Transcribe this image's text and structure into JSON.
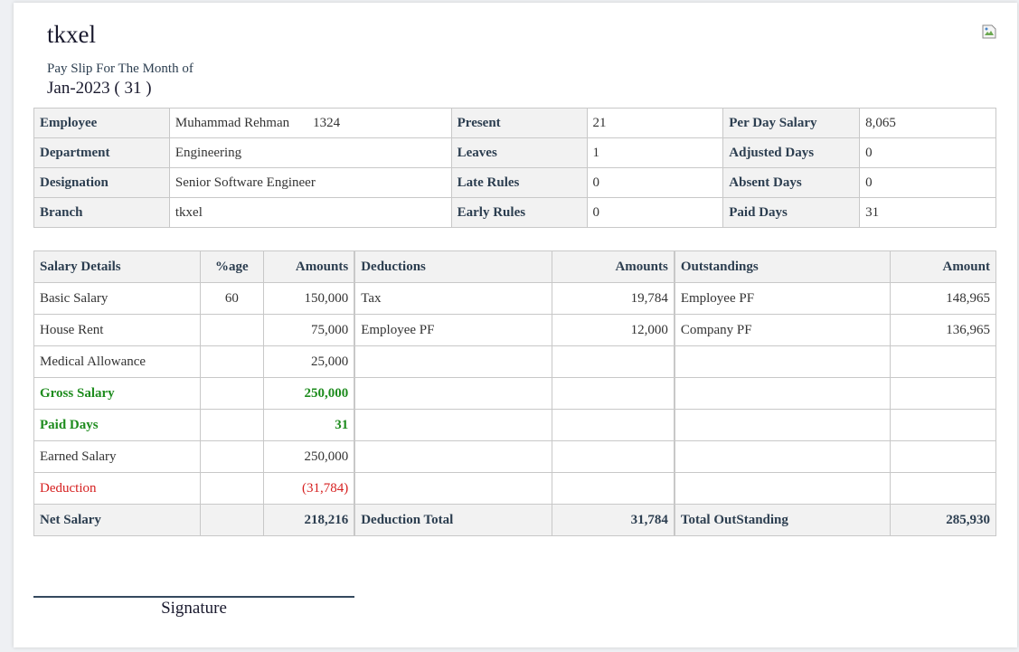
{
  "header": {
    "company": "tkxel",
    "subtitle": "Pay Slip For The Month of",
    "period": "Jan-2023 ( 31 )"
  },
  "info": {
    "employee_label": "Employee",
    "employee_name": "Muhammad Rehman",
    "employee_id": "1324",
    "department_label": "Department",
    "department": "Engineering",
    "designation_label": "Designation",
    "designation": "Senior Software Engineer",
    "branch_label": "Branch",
    "branch": "tkxel",
    "present_label": "Present",
    "present": "21",
    "leaves_label": "Leaves",
    "leaves": "1",
    "late_label": "Late Rules",
    "late": "0",
    "early_label": "Early Rules",
    "early": "0",
    "perday_label": "Per Day Salary",
    "perday": "8,065",
    "adjusted_label": "Adjusted Days",
    "adjusted": "0",
    "absent_label": "Absent Days",
    "absent": "0",
    "paid_label": "Paid Days",
    "paid": "31"
  },
  "salary": {
    "headers": {
      "details": "Salary Details",
      "pct": "%age",
      "amounts": "Amounts",
      "deductions": "Deductions",
      "ded_amounts": "Amounts",
      "outstandings": "Outstandings",
      "out_amount": "Amount"
    },
    "rows": [
      {
        "name": "Basic Salary",
        "pct": "60",
        "amount": "150,000",
        "ded": "Tax",
        "ded_amount": "19,784",
        "out": "Employee PF",
        "out_amount": "148,965"
      },
      {
        "name": "House Rent",
        "pct": "",
        "amount": "75,000",
        "ded": "Employee PF",
        "ded_amount": "12,000",
        "out": "Company PF",
        "out_amount": "136,965"
      },
      {
        "name": "Medical Allowance",
        "pct": "",
        "amount": "25,000",
        "ded": "",
        "ded_amount": "",
        "out": "",
        "out_amount": ""
      },
      {
        "name": "Gross Salary",
        "pct": "",
        "amount": "250,000",
        "ded": "",
        "ded_amount": "",
        "out": "",
        "out_amount": ""
      },
      {
        "name": "Paid Days",
        "pct": "",
        "amount": "31",
        "ded": "",
        "ded_amount": "",
        "out": "",
        "out_amount": ""
      },
      {
        "name": "Earned Salary",
        "pct": "",
        "amount": "250,000",
        "ded": "",
        "ded_amount": "",
        "out": "",
        "out_amount": ""
      },
      {
        "name": "Deduction",
        "pct": "",
        "amount": "(31,784)",
        "ded": "",
        "ded_amount": "",
        "out": "",
        "out_amount": ""
      }
    ],
    "totals": {
      "net_label": "Net Salary",
      "net": "218,216",
      "ded_label": "Deduction Total",
      "ded_total": "31,784",
      "out_label": "Total OutStanding",
      "out_total": "285,930"
    }
  },
  "signature": "Signature",
  "colors": {
    "green": "#1e8c1e",
    "red": "#d62020",
    "header_bg": "#f2f2f2"
  }
}
